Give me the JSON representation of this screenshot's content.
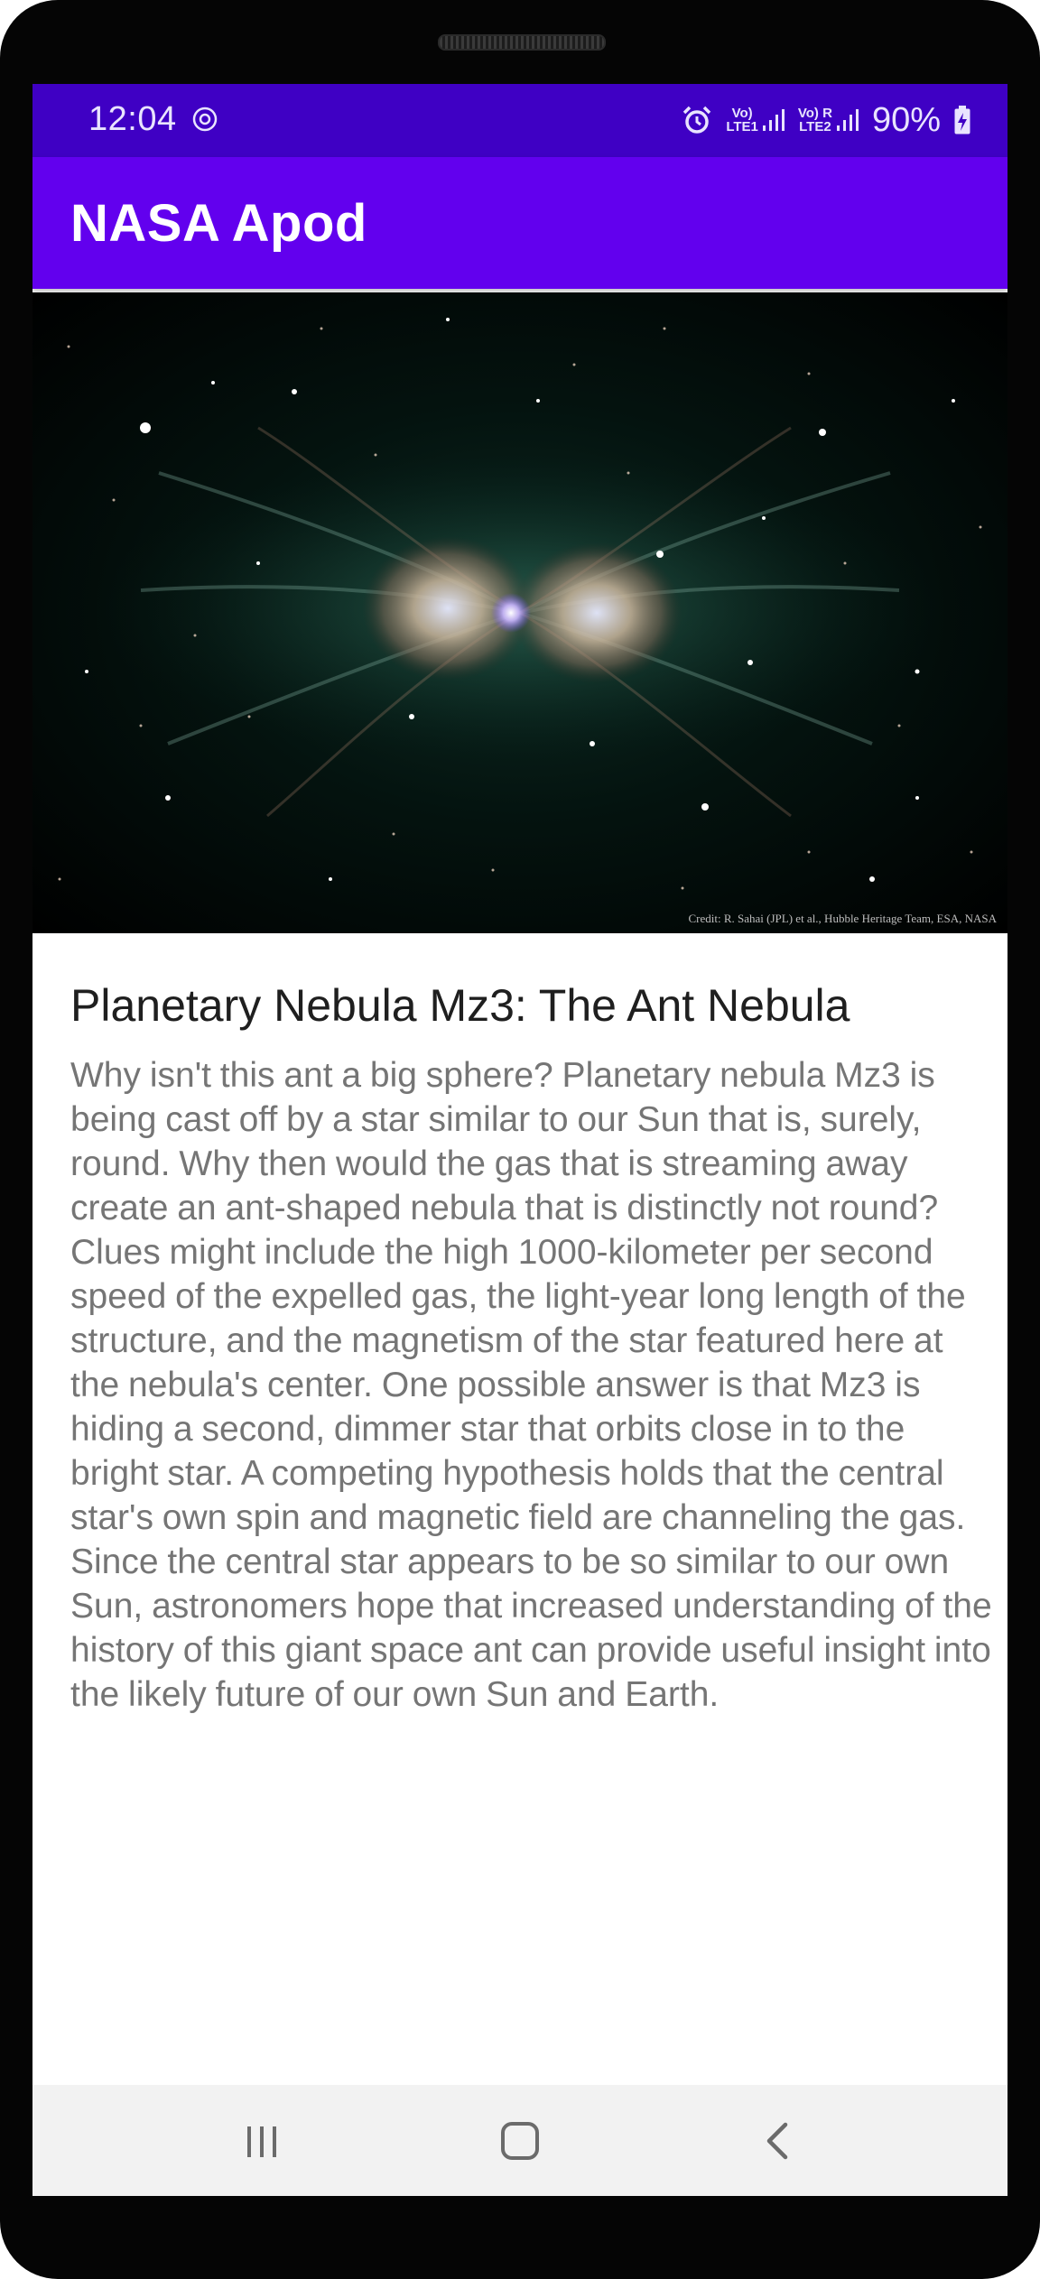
{
  "status_bar": {
    "time": "12:04",
    "sim1_label": "Vo)\nLTE1",
    "sim2_label": "Vo) R\nLTE2",
    "battery": "90%",
    "icons": [
      "sync-icon",
      "alarm-icon",
      "signal-icon",
      "battery-charging-icon"
    ]
  },
  "app_bar": {
    "title": "NASA Apod"
  },
  "apod": {
    "image_credit": "Credit: R. Sahai (JPL) et al., Hubble Heritage Team, ESA, NASA",
    "title": "Planetary Nebula Mz3: The Ant Nebula",
    "explanation": "Why isn't this ant a big sphere?  Planetary nebula Mz3 is being cast off by a star similar to our Sun that is, surely, round.  Why then would the gas that is streaming away create an ant-shaped nebula that is distinctly not round?  Clues might include the high 1000-kilometer per second speed of the expelled gas, the light-year long length of the structure, and the magnetism of the star featured here at the nebula's center.  One possible answer is that Mz3 is hiding a second, dimmer star that orbits close in to the bright star.  A competing hypothesis holds that the central star's own spin and magnetic field are channeling the gas.  Since the central star appears to be so similar to our own Sun, astronomers hope that increased understanding of the history of this giant space ant can provide useful insight into the likely future of our own Sun and Earth."
  },
  "nav_bar": {
    "icons": [
      "recents-icon",
      "home-icon",
      "back-icon"
    ]
  },
  "colors": {
    "status_bar": "#3f00c4",
    "app_bar": "#6200ee",
    "title_text": "#1f1f1f",
    "body_text": "#757575",
    "nav_bar": "#f2f2f2"
  }
}
